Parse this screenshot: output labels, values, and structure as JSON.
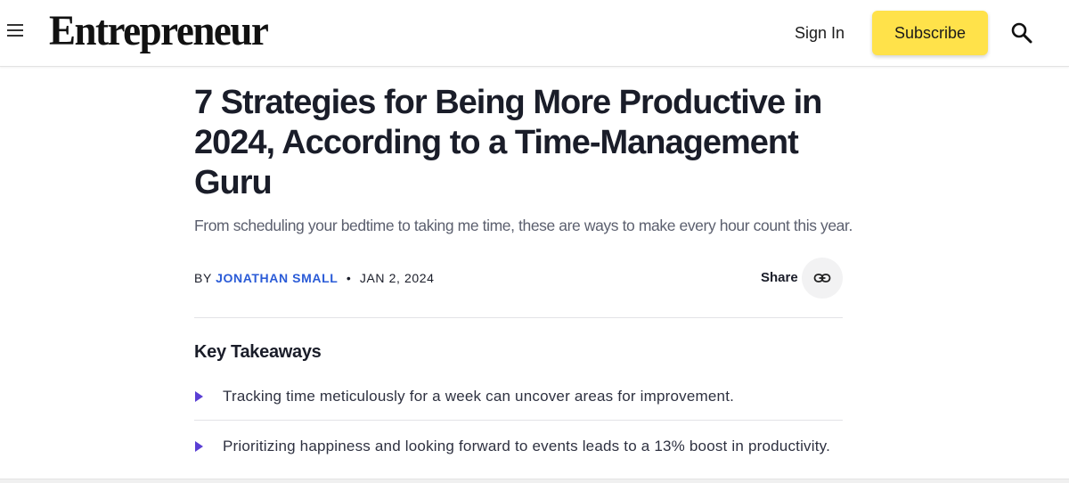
{
  "header": {
    "logo": "Entrepreneur",
    "signin_label": "Sign In",
    "subscribe_label": "Subscribe",
    "subscribe_color": "#ffe24a"
  },
  "article": {
    "title": "7 Strategies for Being More Productive in 2024, According to a Time-Management Guru",
    "subtitle": "From scheduling your bedtime to taking me time, these are ways to make every hour count this year.",
    "byline_prefix": "BY",
    "author": "JONATHAN SMALL",
    "separator": "•",
    "date": "JAN 2, 2024",
    "share_label": "Share",
    "author_color": "#2a5bd7"
  },
  "key_takeaways": {
    "title": "Key Takeaways",
    "bullet_color": "#5a3fd4",
    "items": [
      "Tracking time meticulously for a week can uncover areas for improvement.",
      "Prioritizing happiness and looking forward to events leads to a 13% boost in productivity."
    ]
  },
  "icons": {
    "menu": "hamburger-menu-icon",
    "search": "search-icon",
    "share": "link-icon",
    "bullet": "triangle-right-icon"
  }
}
